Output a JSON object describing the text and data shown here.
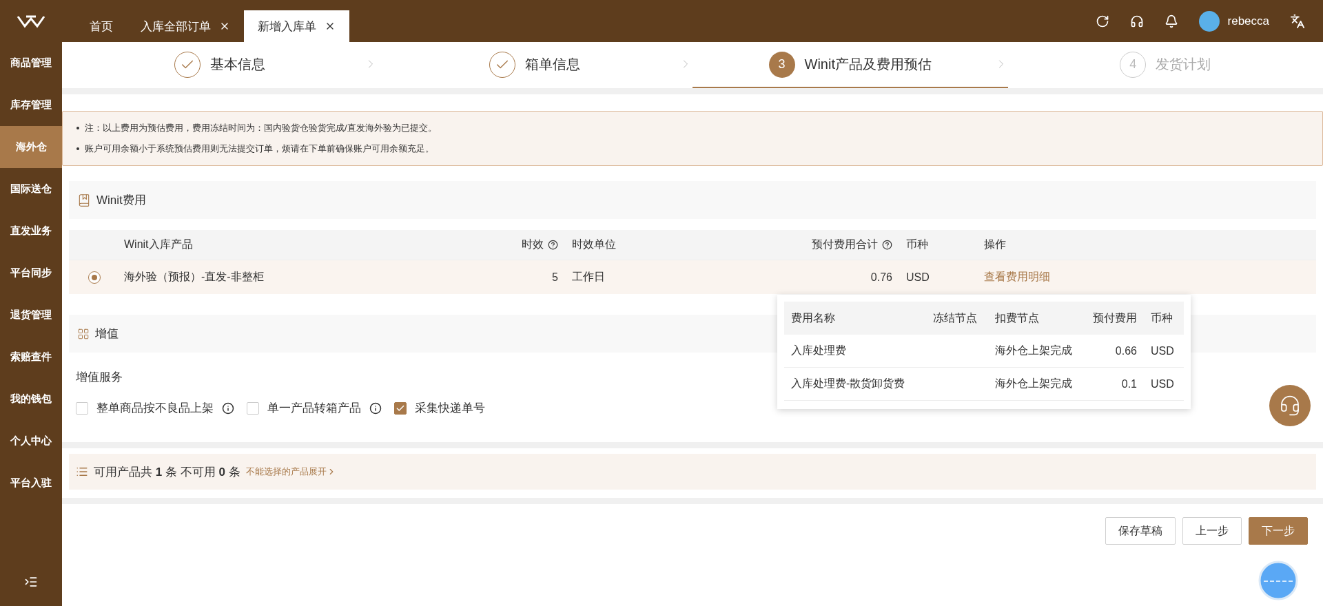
{
  "tabs": [
    {
      "label": "首页",
      "closable": false,
      "selected": false
    },
    {
      "label": "入库全部订单",
      "closable": true,
      "selected": false
    },
    {
      "label": "新增入库单",
      "closable": true,
      "selected": true
    }
  ],
  "user": {
    "name": "rebecca"
  },
  "sidebar": {
    "items": [
      {
        "label": "商品管理",
        "selected": false
      },
      {
        "label": "库存管理",
        "selected": false
      },
      {
        "label": "海外仓",
        "selected": true
      },
      {
        "label": "国际送仓",
        "selected": false
      },
      {
        "label": "直发业务",
        "selected": false
      },
      {
        "label": "平台同步",
        "selected": false
      },
      {
        "label": "退货管理",
        "selected": false
      },
      {
        "label": "索赔查件",
        "selected": false
      },
      {
        "label": "我的钱包",
        "selected": false
      },
      {
        "label": "个人中心",
        "selected": false
      },
      {
        "label": "平台入驻",
        "selected": false
      }
    ]
  },
  "steps": [
    {
      "label": "基本信息",
      "completed": true,
      "selected": false
    },
    {
      "label": "箱单信息",
      "completed": true,
      "selected": false
    },
    {
      "label": "Winit产品及费用预估",
      "completed": false,
      "selected": true,
      "number": "3"
    },
    {
      "label": "发货计划",
      "completed": false,
      "selected": false,
      "number": "4"
    }
  ],
  "notes": [
    "注：以上费用为预估费用，费用冻结时间为：国内验货仓验货完成/直发海外验为已提交。",
    "账户可用余额小于系统预估费用则无法提交订单，烦请在下单前确保账户可用余额充足。"
  ],
  "winit_fee": {
    "title": "Winit费用",
    "columns": [
      {
        "label": "Winit入库产品",
        "help": false
      },
      {
        "label": "时效",
        "help": true
      },
      {
        "label": "时效单位",
        "help": false
      },
      {
        "label": "预付费用合计",
        "help": true
      },
      {
        "label": "币种",
        "help": false
      },
      {
        "label": "操作",
        "help": false
      }
    ],
    "rows": [
      {
        "selected": true,
        "product": "海外验（预报）-直发-非整柜",
        "duration": "5",
        "unit": "工作日",
        "total": "0.76",
        "currency": "USD",
        "action": "查看费用明细"
      }
    ]
  },
  "fee_popup": {
    "columns": [
      "费用名称",
      "冻结节点",
      "扣费节点",
      "预付费用",
      "币种"
    ],
    "rows": [
      {
        "name": "入库处理费",
        "charge_node": "海外仓上架完成",
        "amount": "0.66",
        "currency": "USD"
      },
      {
        "name": "入库处理费-散货卸货费",
        "charge_node": "海外仓上架完成",
        "amount": "0.1",
        "currency": "USD"
      }
    ]
  },
  "value_added": {
    "title": "增值",
    "label": "增值服务",
    "options": [
      {
        "label": "整单商品按不良品上架",
        "checked": false,
        "info": true
      },
      {
        "label": "单一产品转箱产品",
        "checked": false,
        "info": true
      },
      {
        "label": "采集快递单号",
        "checked": true,
        "info": false
      }
    ]
  },
  "availability": {
    "text": "可用产品共 **1** 条 不可用 **0** 条",
    "link": "不能选择的产品展开"
  },
  "buttons": [
    {
      "label": "保存草稿",
      "primary": false
    },
    {
      "label": "上一步",
      "primary": false
    },
    {
      "label": "下一步",
      "primary": true
    }
  ]
}
